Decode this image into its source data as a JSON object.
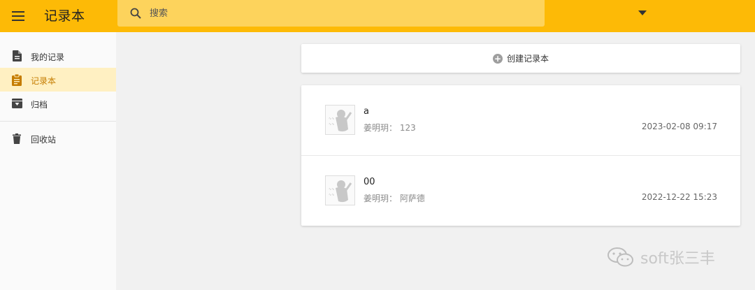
{
  "header": {
    "title": "记录本",
    "search_placeholder": "搜索",
    "menu_icon": "menu-icon",
    "search_icon": "search-icon",
    "dropdown_icon": "arrow-drop-down-icon",
    "bar_color": "#fdba06"
  },
  "sidebar": {
    "items": [
      {
        "label": "我的记录",
        "icon": "document-icon",
        "active": false
      },
      {
        "label": "记录本",
        "icon": "clipboard-icon",
        "active": true
      },
      {
        "label": "归档",
        "icon": "archive-icon",
        "active": false
      },
      {
        "label": "回收站",
        "icon": "trash-icon",
        "active": false
      }
    ],
    "active_color": "#c57c00"
  },
  "main": {
    "create_label": "创建记录本",
    "create_icon": "add-circle-icon",
    "notebooks": [
      {
        "name": "a",
        "author": "姜明玥：",
        "desc": "123",
        "date": "2023-02-08 09:17"
      },
      {
        "name": "00",
        "author": "姜明玥：",
        "desc": "阿萨德",
        "date": "2022-12-22 15:23"
      }
    ]
  },
  "watermark": {
    "text": "soft张三丰",
    "icon": "wechat-icon"
  }
}
